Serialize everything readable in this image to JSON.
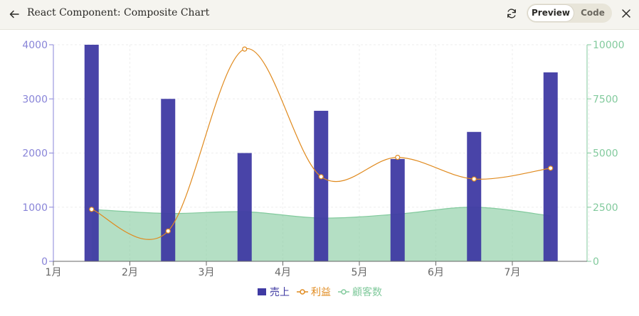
{
  "header": {
    "title": "React Component: Composite Chart",
    "preview_label": "Preview",
    "code_label": "Code"
  },
  "icons": {
    "back": "arrow-left-icon",
    "refresh": "refresh-icon",
    "close": "close-icon"
  },
  "colors": {
    "sales": "#3f3aa3",
    "profit": "#e08a1e",
    "customers": "#82ca9d",
    "left_axis": "#8884d8",
    "right_axis": "#82ca9d",
    "x_axis": "#666666"
  },
  "chart_data": {
    "type": "composite",
    "categories": [
      "1月",
      "2月",
      "3月",
      "4月",
      "5月",
      "6月",
      "7月"
    ],
    "series": [
      {
        "name": "売上",
        "type": "bar",
        "axis": "left",
        "values": [
          4000,
          3000,
          2000,
          2780,
          1890,
          2390,
          3490
        ]
      },
      {
        "name": "利益",
        "type": "line",
        "axis": "right",
        "values": [
          2400,
          1398,
          9800,
          3908,
          4800,
          3800,
          4300
        ]
      },
      {
        "name": "顧客数",
        "type": "area",
        "axis": "right",
        "values": [
          2400,
          2210,
          2290,
          2000,
          2181,
          2500,
          2100
        ]
      }
    ],
    "left_axis": {
      "ticks": [
        "0",
        "1000",
        "2000",
        "3000",
        "4000"
      ],
      "range": [
        0,
        4000
      ]
    },
    "right_axis": {
      "ticks": [
        "0",
        "2500",
        "5000",
        "7500",
        "10000"
      ],
      "range": [
        0,
        10000
      ]
    },
    "grid": true,
    "legend_position": "bottom"
  }
}
